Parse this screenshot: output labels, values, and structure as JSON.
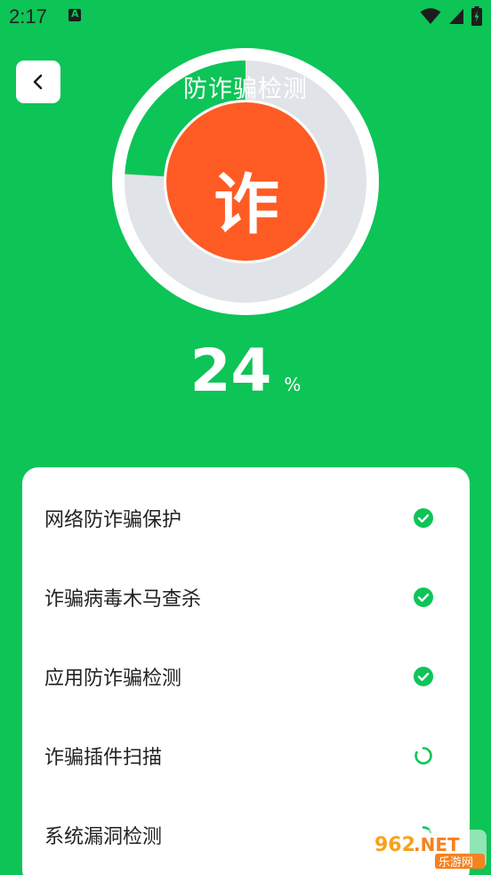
{
  "status_bar": {
    "time": "2:17",
    "app_icon": "a-icon",
    "icons": [
      "wifi-icon",
      "signal-icon",
      "battery-icon"
    ]
  },
  "header": {
    "title": "防诈骗检测",
    "back_icon": "chevron-left-icon"
  },
  "scanner": {
    "center_char": "诈",
    "progress_percent": 24,
    "percent_value": "24",
    "percent_sign": "%"
  },
  "colors": {
    "background": "#0DC457",
    "ring_track": "#E0E3E8",
    "ring_progress": "#0DC457",
    "center_circle": "#FF5B24",
    "check": "#0DC457"
  },
  "checklist": {
    "items": [
      {
        "label": "网络防诈骗保护",
        "status": "done",
        "icon": "check-circle-icon"
      },
      {
        "label": "诈骗病毒木马查杀",
        "status": "done",
        "icon": "check-circle-icon"
      },
      {
        "label": "应用防诈骗检测",
        "status": "done",
        "icon": "check-circle-icon"
      },
      {
        "label": "诈骗插件扫描",
        "status": "scanning",
        "icon": "loading-spinner-icon"
      },
      {
        "label": "系统漏洞检测",
        "status": "scanning",
        "icon": "loading-spinner-icon"
      }
    ]
  },
  "watermark": {
    "logo_text": "962.NET",
    "caption": "乐游网"
  }
}
